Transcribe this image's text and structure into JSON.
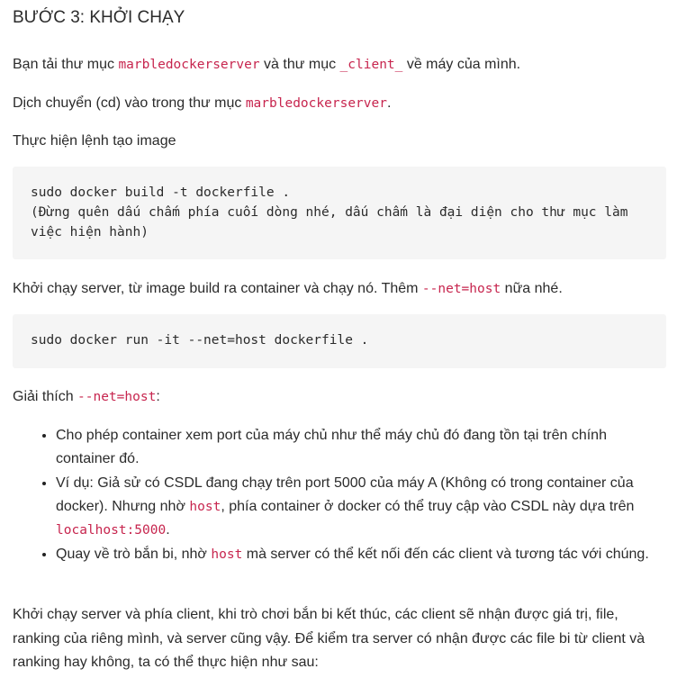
{
  "heading": "BƯỚC 3: KHỞI CHẠY",
  "p1": {
    "before": "Bạn tải thư mục ",
    "code1": "marbledockerserver",
    "mid": " và thư mục ",
    "code2": "_client_",
    "after": " về máy của mình."
  },
  "p2": {
    "before": "Dịch chuyển (cd) vào trong thư mục ",
    "code": "marbledockerserver",
    "after": "."
  },
  "p3": "Thực hiện lệnh tạo image",
  "code_block_1": "sudo docker build -t dockerfile .\n(Đừng quên dấu chấm phía cuối dòng nhé, dấu chấm là đại diện cho thư mục làm việc hiện hành)",
  "p4": {
    "before": "Khởi chạy server, từ image build ra container và chạy nó. Thêm ",
    "code": "--net=host",
    "after": " nữa nhé."
  },
  "code_block_2": "sudo docker run -it --net=host dockerfile .",
  "p5": {
    "before": "Giải thích ",
    "code": "--net=host",
    "after": ":"
  },
  "bullets": [
    {
      "text": "Cho phép container xem port của máy chủ như thể máy chủ đó đang tồn tại trên chính container đó."
    },
    {
      "before": "Ví dụ: Giả sử có CSDL đang chạy trên port 5000 của máy A (Không có trong container của docker). Nhưng nhờ ",
      "code1": "host",
      "mid": ", phía container ở docker có thể truy cập vào CSDL này dựa trên ",
      "code2": "localhost:5000",
      "after": "."
    },
    {
      "before": "Quay về trò bắn bi, nhờ ",
      "code": "host",
      "after": " mà server có thể kết nối đến các client và tương tác với chúng."
    }
  ],
  "p6": "Khởi chạy server và phía client, khi trò chơi bắn bi kết thúc, các client sẽ nhận được giá trị, file, ranking của riêng mình, và server cũng vậy. Để kiểm tra server có nhận được các file bi từ client và ranking hay không, ta có thể thực hiện như sau:"
}
